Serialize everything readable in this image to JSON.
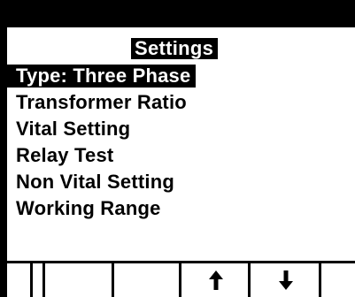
{
  "screen": {
    "title": "Settings",
    "menu": {
      "items": [
        {
          "label": "Type: Three Phase",
          "selected": true
        },
        {
          "label": "Transformer Ratio",
          "selected": false
        },
        {
          "label": "Vital Setting",
          "selected": false
        },
        {
          "label": "Relay Test",
          "selected": false
        },
        {
          "label": "Non Vital Setting",
          "selected": false
        },
        {
          "label": "Working Range",
          "selected": false
        }
      ]
    },
    "softkeys": [
      {
        "icon": "",
        "label": ""
      },
      {
        "icon": "",
        "label": ""
      },
      {
        "icon": "",
        "label": ""
      },
      {
        "icon": "up-arrow-icon",
        "label": ""
      },
      {
        "icon": "down-arrow-icon",
        "label": ""
      },
      {
        "icon": "",
        "label": ""
      }
    ]
  },
  "colors": {
    "background": "#000000",
    "screen": "#ffffff",
    "text": "#000000",
    "highlight": "#000000",
    "highlight_text": "#ffffff"
  }
}
